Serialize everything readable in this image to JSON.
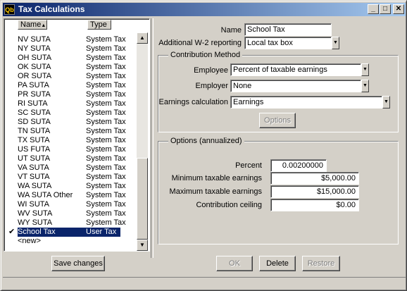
{
  "window": {
    "title": "Tax Calculations"
  },
  "list": {
    "headers": {
      "name": "Name",
      "type": "Type"
    },
    "rows": [
      {
        "name": "NV SUTA",
        "type": "System Tax"
      },
      {
        "name": "NY SUTA",
        "type": "System Tax"
      },
      {
        "name": "OH SUTA",
        "type": "System Tax"
      },
      {
        "name": "OK SUTA",
        "type": "System Tax"
      },
      {
        "name": "OR SUTA",
        "type": "System Tax"
      },
      {
        "name": "PA SUTA",
        "type": "System Tax"
      },
      {
        "name": "PR SUTA",
        "type": "System Tax"
      },
      {
        "name": "RI SUTA",
        "type": "System Tax"
      },
      {
        "name": "SC SUTA",
        "type": "System Tax"
      },
      {
        "name": "SD SUTA",
        "type": "System Tax"
      },
      {
        "name": "TN SUTA",
        "type": "System Tax"
      },
      {
        "name": "TX SUTA",
        "type": "System Tax"
      },
      {
        "name": "US FUTA",
        "type": "System Tax"
      },
      {
        "name": "UT SUTA",
        "type": "System Tax"
      },
      {
        "name": "VA SUTA",
        "type": "System Tax"
      },
      {
        "name": "VT SUTA",
        "type": "System Tax"
      },
      {
        "name": "WA SUTA",
        "type": "System Tax"
      },
      {
        "name": "WA SUTA Other",
        "type": "System Tax"
      },
      {
        "name": "WI SUTA",
        "type": "System Tax"
      },
      {
        "name": "WV SUTA",
        "type": "System Tax"
      },
      {
        "name": "WY SUTA",
        "type": "System Tax"
      },
      {
        "name": "School Tax",
        "type": "User Tax"
      },
      {
        "name": "<new>",
        "type": ""
      }
    ],
    "selected_check": "✔"
  },
  "buttons": {
    "save_changes": "Save changes",
    "ok": "OK",
    "delete": "Delete",
    "restore": "Restore",
    "options": "Options"
  },
  "form": {
    "name_label": "Name",
    "name_value": "School Tax",
    "w2_label": "Additional W-2 reporting",
    "w2_value": "Local tax box",
    "contribution_title": "Contribution Method",
    "employee_label": "Employee",
    "employee_value": "Percent of taxable earnings",
    "employer_label": "Employer",
    "employer_value": "None",
    "earnings_label": "Earnings calculation",
    "earnings_value": "Earnings",
    "options_title": "Options (annualized)",
    "percent_label": "Percent",
    "percent_value": "0.00200000",
    "min_label": "Minimum taxable earnings",
    "min_value": "$5,000.00",
    "max_label": "Maximum taxable earnings",
    "max_value": "$15,000.00",
    "ceiling_label": "Contribution ceiling",
    "ceiling_value": "$0.00"
  }
}
